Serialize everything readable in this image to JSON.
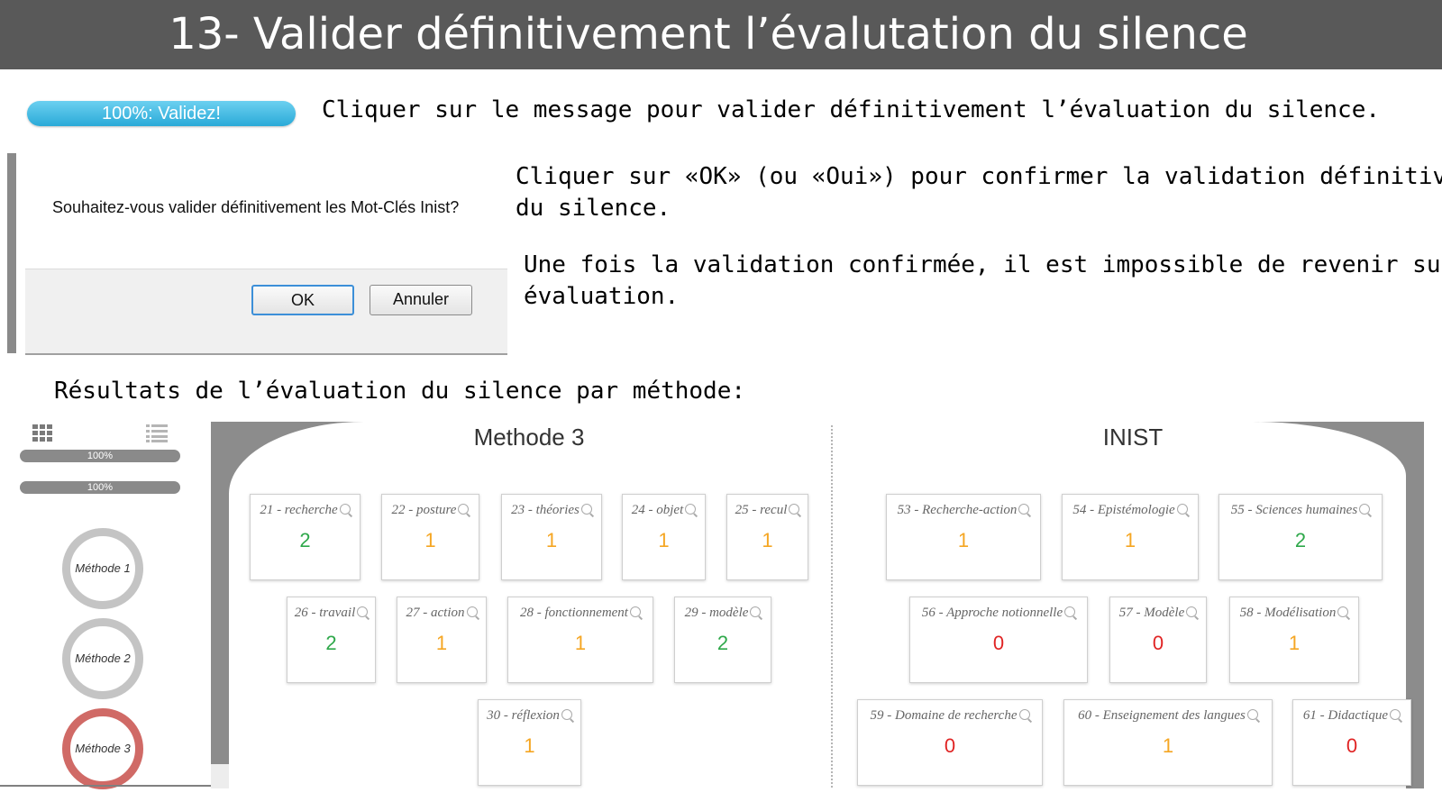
{
  "slide": {
    "title": "13- Valider définitivement l’évalutation du silence",
    "instruction_1": "Cliquer sur le message pour valider définitivement l’évaluation du silence.",
    "instruction_2_line1": "Cliquer sur «OK» (ou «Oui») pour confirmer la validation définitive",
    "instruction_2_line2": "du silence.",
    "instruction_3_line1": "Une fois la validation confirmée, il est impossible de revenir sur une",
    "instruction_3_line2": "évaluation.",
    "results_heading": "Résultats de l’évaluation du silence par méthode:"
  },
  "validate_button": {
    "label": "100%: Validez!"
  },
  "dialog": {
    "question": "Souhaitez-vous valider définitivement les Mot-Clés Inist?",
    "ok_label": "OK",
    "cancel_label": "Annuler"
  },
  "sidebar": {
    "progress_bars": [
      {
        "label": "100%",
        "value": 1.0
      },
      {
        "label": "100%",
        "value": 1.0
      }
    ],
    "methods": [
      {
        "label": "Méthode 1",
        "active": false
      },
      {
        "label": "Méthode 2",
        "active": false
      },
      {
        "label": "Méthode 3",
        "active": true
      }
    ]
  },
  "colors": {
    "green": "#2ea84a",
    "orange": "#f5a623",
    "red": "#e02424",
    "accent_blue": "#2aaad8",
    "active_method": "#d06a66"
  },
  "panels": [
    {
      "heading": "Methode 3",
      "cards": [
        {
          "label": "21 - recherche",
          "value": "2",
          "color": "green"
        },
        {
          "label": "22 - posture",
          "value": "1",
          "color": "orange"
        },
        {
          "label": "23 - théories",
          "value": "1",
          "color": "orange"
        },
        {
          "label": "24 - objet",
          "value": "1",
          "color": "orange"
        },
        {
          "label": "25 - recul",
          "value": "1",
          "color": "orange"
        },
        {
          "label": "26 - travail",
          "value": "2",
          "color": "green"
        },
        {
          "label": "27 - action",
          "value": "1",
          "color": "orange"
        },
        {
          "label": "28 - fonctionnement",
          "value": "1",
          "color": "orange"
        },
        {
          "label": "29 - modèle",
          "value": "2",
          "color": "green"
        },
        {
          "label": "30 - réflexion",
          "value": "1",
          "color": "orange"
        }
      ]
    },
    {
      "heading": "INIST",
      "cards": [
        {
          "label": "53 - Recherche-action",
          "value": "1",
          "color": "orange"
        },
        {
          "label": "54 - Epistémologie",
          "value": "1",
          "color": "orange"
        },
        {
          "label": "55 - Sciences humaines",
          "value": "2",
          "color": "green"
        },
        {
          "label": "56 - Approche notionnelle",
          "value": "0",
          "color": "red"
        },
        {
          "label": "57 - Modèle",
          "value": "0",
          "color": "red"
        },
        {
          "label": "58 - Modélisation",
          "value": "1",
          "color": "orange"
        },
        {
          "label": "59 - Domaine de recherche",
          "value": "0",
          "color": "red"
        },
        {
          "label": "60 - Enseignement des langues",
          "value": "1",
          "color": "orange"
        },
        {
          "label": "61 - Didactique",
          "value": "0",
          "color": "red"
        }
      ]
    }
  ]
}
